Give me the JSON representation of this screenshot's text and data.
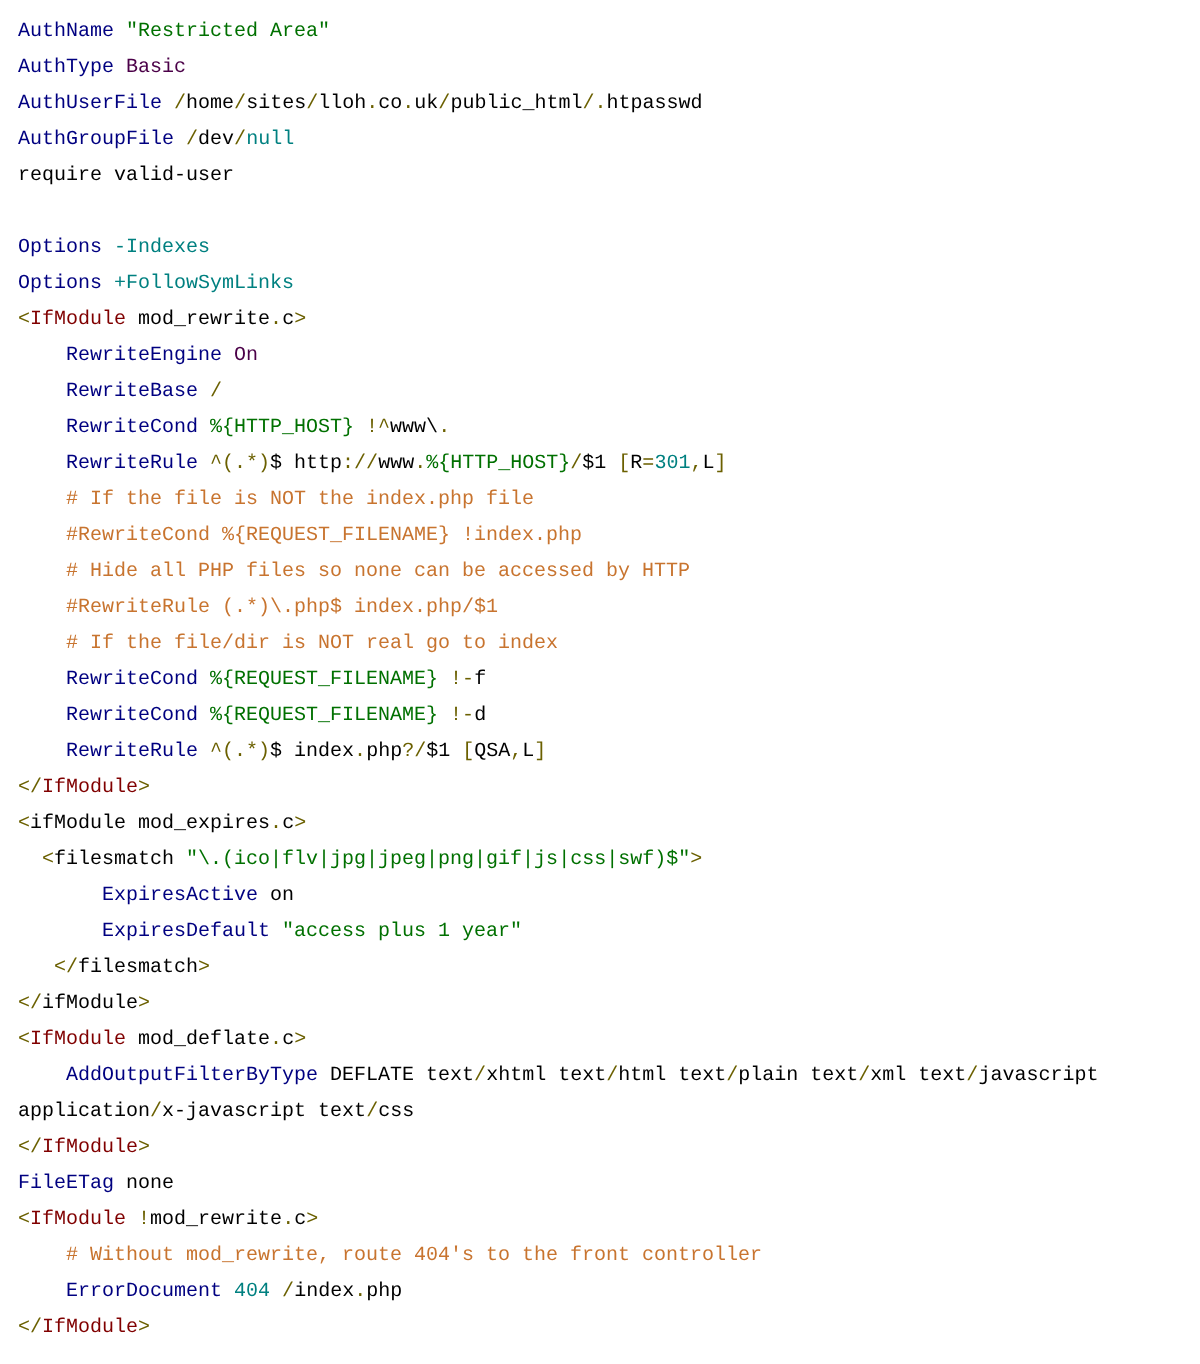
{
  "code_lines": [
    {
      "kind": "code",
      "tokens": [
        {
          "kind": "directive",
          "text": "AuthName"
        },
        {
          "kind": "string",
          "text": " \"Restricted Area\""
        }
      ]
    },
    {
      "kind": "code",
      "tokens": [
        {
          "kind": "directive",
          "text": "AuthType"
        },
        {
          "kind": "keyword",
          "text": " Basic"
        }
      ]
    },
    {
      "kind": "code",
      "tokens": [
        {
          "kind": "directive",
          "text": "AuthUserFile"
        },
        {
          "kind": "punct",
          "text": " /"
        },
        {
          "kind": "text",
          "text": "home"
        },
        {
          "kind": "punct",
          "text": "/"
        },
        {
          "kind": "text",
          "text": "sites"
        },
        {
          "kind": "punct",
          "text": "/"
        },
        {
          "kind": "text",
          "text": "lloh"
        },
        {
          "kind": "punct",
          "text": "."
        },
        {
          "kind": "text",
          "text": "co"
        },
        {
          "kind": "punct",
          "text": "."
        },
        {
          "kind": "text",
          "text": "uk"
        },
        {
          "kind": "punct",
          "text": "/"
        },
        {
          "kind": "text",
          "text": "public_html"
        },
        {
          "kind": "punct",
          "text": "/."
        },
        {
          "kind": "text",
          "text": "htpasswd"
        }
      ]
    },
    {
      "kind": "code",
      "tokens": [
        {
          "kind": "directive",
          "text": "AuthGroupFile"
        },
        {
          "kind": "punct",
          "text": " /"
        },
        {
          "kind": "text",
          "text": "dev"
        },
        {
          "kind": "punct",
          "text": "/"
        },
        {
          "kind": "value",
          "text": "null"
        }
      ]
    },
    {
      "kind": "code",
      "tokens": [
        {
          "kind": "text",
          "text": "require valid-user"
        }
      ]
    },
    {
      "kind": "blank"
    },
    {
      "kind": "code",
      "tokens": [
        {
          "kind": "directive",
          "text": "Options"
        },
        {
          "kind": "value",
          "text": " -Indexes"
        }
      ]
    },
    {
      "kind": "code",
      "tokens": [
        {
          "kind": "directive",
          "text": "Options"
        },
        {
          "kind": "value",
          "text": " +FollowSymLinks"
        }
      ]
    },
    {
      "kind": "code",
      "tokens": [
        {
          "kind": "punct",
          "text": "<"
        },
        {
          "kind": "tag",
          "text": "IfModule"
        },
        {
          "kind": "text",
          "text": " mod_rewrite"
        },
        {
          "kind": "punct",
          "text": "."
        },
        {
          "kind": "text",
          "text": "c"
        },
        {
          "kind": "punct",
          "text": ">"
        }
      ]
    },
    {
      "kind": "code",
      "tokens": [
        {
          "kind": "directive",
          "text": "    RewriteEngine"
        },
        {
          "kind": "keyword",
          "text": " On"
        }
      ]
    },
    {
      "kind": "code",
      "tokens": [
        {
          "kind": "directive",
          "text": "    RewriteBase"
        },
        {
          "kind": "punct",
          "text": " /"
        }
      ]
    },
    {
      "kind": "code",
      "tokens": [
        {
          "kind": "directive",
          "text": "    RewriteCond"
        },
        {
          "kind": "string",
          "text": " %{HTTP_HOST}"
        },
        {
          "kind": "punct",
          "text": " !^"
        },
        {
          "kind": "text",
          "text": "www\\"
        },
        {
          "kind": "punct",
          "text": "."
        }
      ]
    },
    {
      "kind": "code",
      "tokens": [
        {
          "kind": "directive",
          "text": "    RewriteRule"
        },
        {
          "kind": "punct",
          "text": " ^(.*)"
        },
        {
          "kind": "text",
          "text": "$ http"
        },
        {
          "kind": "punct",
          "text": "://"
        },
        {
          "kind": "text",
          "text": "www"
        },
        {
          "kind": "punct",
          "text": "."
        },
        {
          "kind": "string",
          "text": "%{HTTP_HOST}"
        },
        {
          "kind": "punct",
          "text": "/"
        },
        {
          "kind": "text",
          "text": "$1"
        },
        {
          "kind": "punct",
          "text": " ["
        },
        {
          "kind": "text",
          "text": "R"
        },
        {
          "kind": "punct",
          "text": "="
        },
        {
          "kind": "value",
          "text": "301"
        },
        {
          "kind": "punct",
          "text": ","
        },
        {
          "kind": "text",
          "text": "L"
        },
        {
          "kind": "punct",
          "text": "]"
        }
      ]
    },
    {
      "kind": "code",
      "tokens": [
        {
          "kind": "comment",
          "text": "    # If the file is NOT the index.php file"
        }
      ]
    },
    {
      "kind": "code",
      "tokens": [
        {
          "kind": "comment",
          "text": "    #RewriteCond %{REQUEST_FILENAME} !index.php"
        }
      ]
    },
    {
      "kind": "code",
      "tokens": [
        {
          "kind": "comment",
          "text": "    # Hide all PHP files so none can be accessed by HTTP"
        }
      ]
    },
    {
      "kind": "code",
      "tokens": [
        {
          "kind": "comment",
          "text": "    #RewriteRule (.*)\\.php$ index.php/$1"
        }
      ]
    },
    {
      "kind": "code",
      "tokens": [
        {
          "kind": "comment",
          "text": "    # If the file/dir is NOT real go to index"
        }
      ]
    },
    {
      "kind": "code",
      "tokens": [
        {
          "kind": "directive",
          "text": "    RewriteCond"
        },
        {
          "kind": "string",
          "text": " %{REQUEST_FILENAME}"
        },
        {
          "kind": "punct",
          "text": " !-"
        },
        {
          "kind": "text",
          "text": "f"
        }
      ]
    },
    {
      "kind": "code",
      "tokens": [
        {
          "kind": "directive",
          "text": "    RewriteCond"
        },
        {
          "kind": "string",
          "text": " %{REQUEST_FILENAME}"
        },
        {
          "kind": "punct",
          "text": " !-"
        },
        {
          "kind": "text",
          "text": "d"
        }
      ]
    },
    {
      "kind": "code",
      "tokens": [
        {
          "kind": "directive",
          "text": "    RewriteRule"
        },
        {
          "kind": "punct",
          "text": " ^(.*)"
        },
        {
          "kind": "text",
          "text": "$ index"
        },
        {
          "kind": "punct",
          "text": "."
        },
        {
          "kind": "text",
          "text": "php"
        },
        {
          "kind": "punct",
          "text": "?/"
        },
        {
          "kind": "text",
          "text": "$1"
        },
        {
          "kind": "punct",
          "text": " ["
        },
        {
          "kind": "text",
          "text": "QSA"
        },
        {
          "kind": "punct",
          "text": ","
        },
        {
          "kind": "text",
          "text": "L"
        },
        {
          "kind": "punct",
          "text": "]"
        }
      ]
    },
    {
      "kind": "code",
      "tokens": [
        {
          "kind": "punct",
          "text": "</"
        },
        {
          "kind": "tag",
          "text": "IfModule"
        },
        {
          "kind": "punct",
          "text": ">"
        }
      ]
    },
    {
      "kind": "code",
      "tokens": [
        {
          "kind": "punct",
          "text": "<"
        },
        {
          "kind": "text",
          "text": "ifModule mod_expires"
        },
        {
          "kind": "punct",
          "text": "."
        },
        {
          "kind": "text",
          "text": "c"
        },
        {
          "kind": "punct",
          "text": ">"
        }
      ]
    },
    {
      "kind": "code",
      "tokens": [
        {
          "kind": "punct",
          "text": "  <"
        },
        {
          "kind": "text",
          "text": "filesmatch"
        },
        {
          "kind": "string",
          "text": " \"\\.(ico|flv|jpg|jpeg|png|gif|js|css|swf)$\""
        },
        {
          "kind": "punct",
          "text": ">"
        }
      ]
    },
    {
      "kind": "code",
      "tokens": [
        {
          "kind": "directive",
          "text": "       ExpiresActive"
        },
        {
          "kind": "text",
          "text": " on"
        }
      ]
    },
    {
      "kind": "code",
      "tokens": [
        {
          "kind": "directive",
          "text": "       ExpiresDefault"
        },
        {
          "kind": "string",
          "text": " \"access plus 1 year\""
        }
      ]
    },
    {
      "kind": "code",
      "tokens": [
        {
          "kind": "punct",
          "text": "   </"
        },
        {
          "kind": "text",
          "text": "filesmatch"
        },
        {
          "kind": "punct",
          "text": ">"
        }
      ]
    },
    {
      "kind": "code",
      "tokens": [
        {
          "kind": "punct",
          "text": "</"
        },
        {
          "kind": "text",
          "text": "ifModule"
        },
        {
          "kind": "punct",
          "text": ">"
        }
      ]
    },
    {
      "kind": "code",
      "tokens": [
        {
          "kind": "punct",
          "text": "<"
        },
        {
          "kind": "tag",
          "text": "IfModule"
        },
        {
          "kind": "text",
          "text": " mod_deflate"
        },
        {
          "kind": "punct",
          "text": "."
        },
        {
          "kind": "text",
          "text": "c"
        },
        {
          "kind": "punct",
          "text": ">"
        }
      ]
    },
    {
      "kind": "code",
      "tokens": [
        {
          "kind": "directive",
          "text": "    AddOutputFilterByType"
        },
        {
          "kind": "text",
          "text": " DEFLATE text"
        },
        {
          "kind": "punct",
          "text": "/"
        },
        {
          "kind": "text",
          "text": "xhtml text"
        },
        {
          "kind": "punct",
          "text": "/"
        },
        {
          "kind": "text",
          "text": "html text"
        },
        {
          "kind": "punct",
          "text": "/"
        },
        {
          "kind": "text",
          "text": "plain text"
        },
        {
          "kind": "punct",
          "text": "/"
        },
        {
          "kind": "text",
          "text": "xml text"
        },
        {
          "kind": "punct",
          "text": "/"
        },
        {
          "kind": "text",
          "text": "javascript"
        }
      ]
    },
    {
      "kind": "code",
      "tokens": [
        {
          "kind": "text",
          "text": "application"
        },
        {
          "kind": "punct",
          "text": "/"
        },
        {
          "kind": "text",
          "text": "x-javascript text"
        },
        {
          "kind": "punct",
          "text": "/"
        },
        {
          "kind": "text",
          "text": "css"
        }
      ]
    },
    {
      "kind": "code",
      "tokens": [
        {
          "kind": "punct",
          "text": "</"
        },
        {
          "kind": "tag",
          "text": "IfModule"
        },
        {
          "kind": "punct",
          "text": ">"
        }
      ]
    },
    {
      "kind": "code",
      "tokens": [
        {
          "kind": "directive",
          "text": "FileETag"
        },
        {
          "kind": "text",
          "text": " none"
        }
      ]
    },
    {
      "kind": "code",
      "tokens": [
        {
          "kind": "punct",
          "text": "<"
        },
        {
          "kind": "tag",
          "text": "IfModule"
        },
        {
          "kind": "punct",
          "text": " !"
        },
        {
          "kind": "text",
          "text": "mod_rewrite"
        },
        {
          "kind": "punct",
          "text": "."
        },
        {
          "kind": "text",
          "text": "c"
        },
        {
          "kind": "punct",
          "text": ">"
        }
      ]
    },
    {
      "kind": "code",
      "tokens": [
        {
          "kind": "comment",
          "text": "    # Without mod_rewrite, route 404's to the front controller"
        }
      ]
    },
    {
      "kind": "code",
      "tokens": [
        {
          "kind": "directive",
          "text": "    ErrorDocument"
        },
        {
          "kind": "value",
          "text": " 404"
        },
        {
          "kind": "punct",
          "text": " /"
        },
        {
          "kind": "text",
          "text": "index"
        },
        {
          "kind": "punct",
          "text": "."
        },
        {
          "kind": "text",
          "text": "php"
        }
      ]
    },
    {
      "kind": "code",
      "tokens": [
        {
          "kind": "punct",
          "text": "</"
        },
        {
          "kind": "tag",
          "text": "IfModule"
        },
        {
          "kind": "punct",
          "text": ">"
        }
      ]
    }
  ]
}
